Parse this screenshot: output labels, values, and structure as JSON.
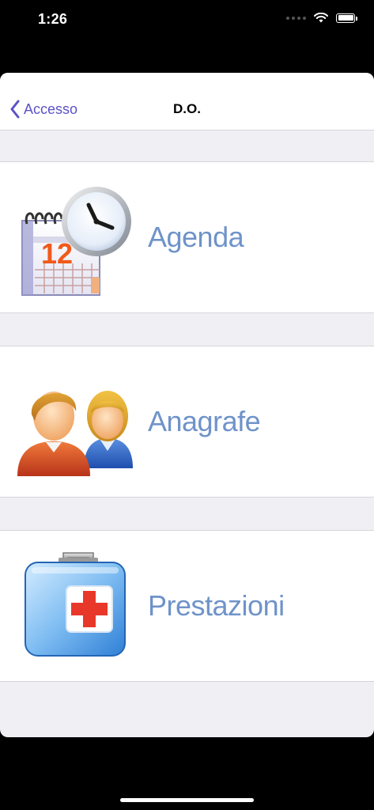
{
  "status_bar": {
    "time": "1:26"
  },
  "nav": {
    "back_label": "Accesso",
    "title": "D.O."
  },
  "menu": {
    "items": [
      {
        "label": "Agenda",
        "icon": "calendar-clock-icon"
      },
      {
        "label": "Anagrafe",
        "icon": "people-icon"
      },
      {
        "label": "Prestazioni",
        "icon": "first-aid-kit-icon"
      }
    ]
  },
  "calendar_icon_day": "12",
  "colors": {
    "accent": "#5b52c7",
    "label": "#6f93c9",
    "background": "#efeff4",
    "aid_red": "#e8382a"
  }
}
